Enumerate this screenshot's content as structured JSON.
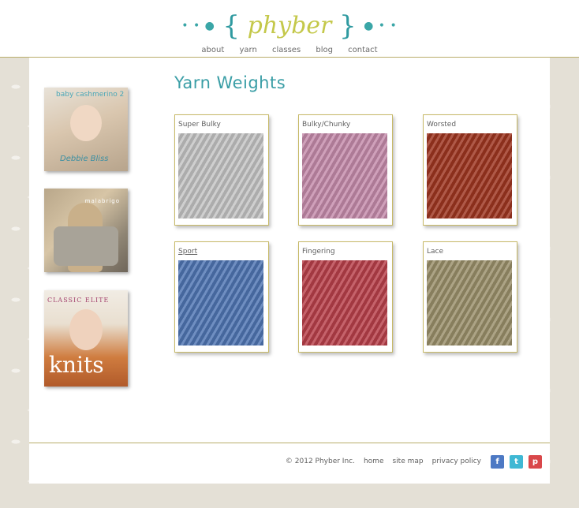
{
  "logo": {
    "dots_left": "• • ●",
    "brace_open": "{",
    "word": "phyber",
    "brace_close": "}",
    "dots_right": "● • •"
  },
  "nav": {
    "items": [
      "about",
      "yarn",
      "classes",
      "blog",
      "contact"
    ]
  },
  "sidebar": {
    "books": [
      {
        "title": "baby cashmerino 2",
        "author": "Debbie Bliss"
      },
      {
        "brand": "malabrigo"
      },
      {
        "brand": "CLASSIC ELITE",
        "title": "knits"
      }
    ]
  },
  "main": {
    "title": "Yarn Weights",
    "cards": [
      {
        "label": "Super Bulky",
        "color": "#c4c4c4"
      },
      {
        "label": "Bulky/Chunky",
        "color": "#c58bab"
      },
      {
        "label": "Worsted",
        "color": "#9e3520"
      },
      {
        "label": "Sport",
        "color": "#4f75b3"
      },
      {
        "label": "Fingering",
        "color": "#b8404a"
      },
      {
        "label": "Lace",
        "color": "#9a8f6a"
      }
    ]
  },
  "footer": {
    "copyright": "© 2012 Phyber Inc.",
    "links": [
      "home",
      "site map",
      "privacy policy"
    ],
    "social": {
      "facebook": "f",
      "twitter": "t",
      "pinterest": "p"
    }
  },
  "colors": {
    "accent": "#3a9ea6",
    "logo_word": "#c4c84a",
    "card_border": "#c7b967"
  }
}
